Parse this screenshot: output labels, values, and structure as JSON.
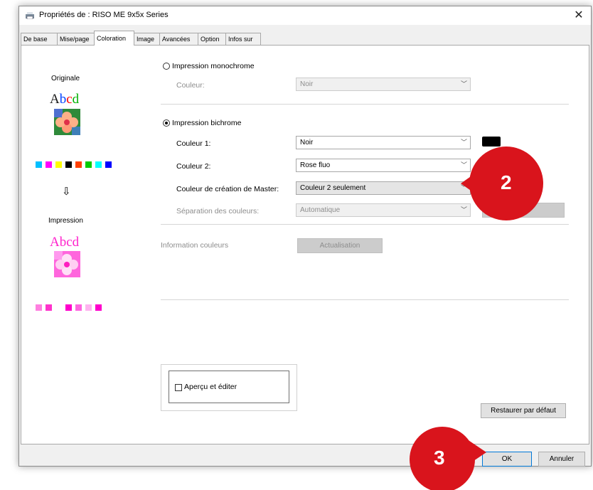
{
  "window": {
    "title": "Propriétés de : RISO ME 9x5x Series"
  },
  "tabs": [
    {
      "label": "De base"
    },
    {
      "label": "Mise/page"
    },
    {
      "label": "Coloration",
      "active": true
    },
    {
      "label": "Image"
    },
    {
      "label": "Avancées"
    },
    {
      "label": "Option"
    },
    {
      "label": "Infos sur"
    }
  ],
  "preview": {
    "original_label": "Originale",
    "print_label": "Impression",
    "sample_text": "Abcd",
    "arrow": "⇩",
    "original_colors": [
      "#00bfff",
      "#ff00ff",
      "#ffff00",
      "#000000",
      "#ff4000",
      "#00cc00",
      "#00ffff",
      "#0000ff"
    ],
    "print_colors": [
      "#ff80e0",
      "#ff33cc",
      "#ffffff",
      "#ff00cc",
      "#ff66e0",
      "#ffb3f0",
      "#ff00cc"
    ]
  },
  "mono": {
    "label": "Impression monochrome",
    "couleur_label": "Couleur:",
    "couleur_value": "Noir"
  },
  "bichrome": {
    "label": "Impression bichrome",
    "couleur1_label": "Couleur 1:",
    "couleur1_value": "Noir",
    "couleur1_color": "#000000",
    "couleur2_label": "Couleur 2:",
    "couleur2_value": "Rose fluo",
    "couleur2_color": "#ff00cc",
    "master_label": "Couleur de création de Master:",
    "master_value": "Couleur 2 seulement",
    "separation_label": "Séparation des couleurs:",
    "separation_value": "Automatique"
  },
  "info": {
    "label": "Information couleurs",
    "button": "Actualisation"
  },
  "apercu": {
    "label": "Aperçu et éditer"
  },
  "buttons": {
    "restore": "Restaurer par défaut",
    "ok": "OK",
    "cancel": "Annuler"
  },
  "callouts": {
    "color": "#d9141c",
    "first": "2",
    "second": "3"
  }
}
